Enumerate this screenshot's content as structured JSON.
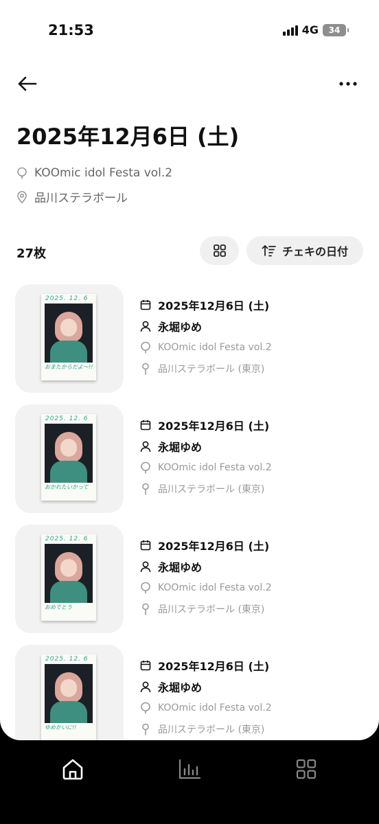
{
  "status_bar": {
    "time": "21:53",
    "network": "4G",
    "battery": "34"
  },
  "header": {
    "title": "2025年12月6日 (土)",
    "event": "KOOmic idol Festa vol.2",
    "venue": "品川ステラボール"
  },
  "toolbar": {
    "count": "27枚",
    "sort_label": "チェキの日付"
  },
  "items": [
    {
      "date": "2025年12月6日 (土)",
      "member": "永堀ゆめ",
      "event": "KOOmic idol Festa vol.2",
      "venue": "品川ステラボール (東京)",
      "ink_date": "2025. 12. 6",
      "ink_note": "おまたからだよ〜!!"
    },
    {
      "date": "2025年12月6日 (土)",
      "member": "永堀ゆめ",
      "event": "KOOmic idol Festa vol.2",
      "venue": "品川ステラボール (東京)",
      "ink_date": "2025. 12. 6",
      "ink_note": "おかれたいかって"
    },
    {
      "date": "2025年12月6日 (土)",
      "member": "永堀ゆめ",
      "event": "KOOmic idol Festa vol.2",
      "venue": "品川ステラボール (東京)",
      "ink_date": "2025. 12. 6",
      "ink_note": "おめでとう"
    },
    {
      "date": "2025年12月6日 (土)",
      "member": "永堀ゆめ",
      "event": "KOOmic idol Festa vol.2",
      "venue": "品川ステラボール (東京)",
      "ink_date": "2025. 12. 6",
      "ink_note": "ゆめかいに!!"
    }
  ],
  "nav": {
    "items": [
      "home-icon",
      "chart-icon",
      "grid-icon"
    ],
    "active": "home-icon"
  },
  "colors": {
    "accent_ink": "#2ca58d",
    "pill_bg": "#f0f0f0",
    "muted": "#999999"
  }
}
